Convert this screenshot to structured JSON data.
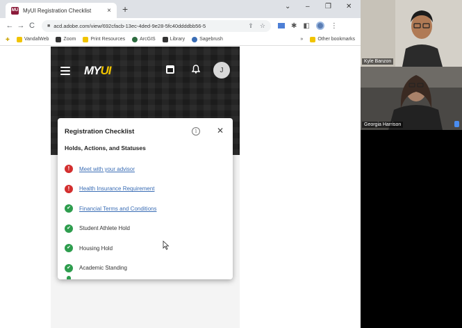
{
  "browser": {
    "tab_title": "MyUI Registration Checklist",
    "tab_favicon_text": "MU",
    "tab_close": "×",
    "new_tab": "+",
    "window_controls": [
      "⌄",
      "–",
      "❐",
      "✕"
    ],
    "url": "acd.adobe.com/view/692cfacb-13ec-4ded-9e28-5fc40ddddbb56-5",
    "bookmarks": [
      {
        "label": "VandalWeb",
        "color": "#f1c400"
      },
      {
        "label": "Zoom",
        "color": "#333333"
      },
      {
        "label": "Print Resources",
        "color": "#f1c400"
      },
      {
        "label": "ArcGIS",
        "color": "#2d6b3f"
      },
      {
        "label": "Library",
        "color": "#333333"
      },
      {
        "label": "Sagebrush",
        "color": "#3a6db5"
      }
    ],
    "bookmarks_more": "»",
    "other_bookmarks": "Other bookmarks"
  },
  "app": {
    "logo_prefix": "MY",
    "logo_suffix": "UI",
    "avatar_initial": "J"
  },
  "checklist": {
    "title": "Registration Checklist",
    "section": "Holds, Actions, and Statuses",
    "items": [
      {
        "label": "Meet with your advisor",
        "status": "alert",
        "link": true
      },
      {
        "label": "Health Insurance Requirement",
        "status": "alert",
        "link": true
      },
      {
        "label": "Financial Terms and Conditions",
        "status": "ok",
        "link": true
      },
      {
        "label": "Student Athlete Hold",
        "status": "ok",
        "link": false
      },
      {
        "label": "Housing Hold",
        "status": "ok",
        "link": false
      },
      {
        "label": "Academic Standing",
        "status": "ok",
        "link": false
      }
    ]
  },
  "participants": [
    {
      "name": "Kyle Banzon"
    },
    {
      "name": "Georgia Harrison"
    }
  ],
  "colors": {
    "alert": "#d32f2f",
    "ok": "#2e9d4e",
    "link": "#3a6db5",
    "brand_gold": "#f1c400"
  }
}
